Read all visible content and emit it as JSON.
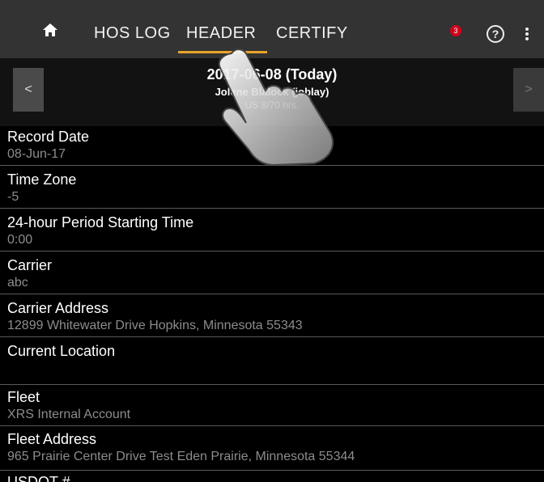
{
  "topbar": {
    "tabs": [
      {
        "label": "HOS LOG"
      },
      {
        "label": "HEADER"
      },
      {
        "label": "CERTIFY"
      }
    ],
    "active_tab": "HEADER",
    "notification_count": "3",
    "accent_color": "#e8a32a",
    "icons": [
      "home-icon",
      "notification-icon",
      "help-icon",
      "more-vert-icon"
    ]
  },
  "subheader": {
    "date": "2017-06-08 (Today)",
    "driver": "Jolene Blalock (joblay)",
    "hours": "US 8/70 hrs.",
    "prev_label": "<",
    "next_label": ">"
  },
  "fields": [
    {
      "label": "Record Date",
      "value": "08-Jun-17"
    },
    {
      "label": "Time Zone",
      "value": "-5"
    },
    {
      "label": "24-hour Period Starting Time",
      "value": "0:00"
    },
    {
      "label": "Carrier",
      "value": "abc"
    },
    {
      "label": "Carrier Address",
      "value": "12899 Whitewater Drive  Hopkins, Minnesota 55343"
    },
    {
      "label": "Current Location",
      "value": ""
    },
    {
      "label": "Fleet",
      "value": "XRS Internal Account"
    },
    {
      "label": "Fleet Address",
      "value": "965 Prairie Center Drive Test Eden Prairie, Minnesota 55344"
    },
    {
      "label": "USDOT #",
      "value": ""
    }
  ]
}
